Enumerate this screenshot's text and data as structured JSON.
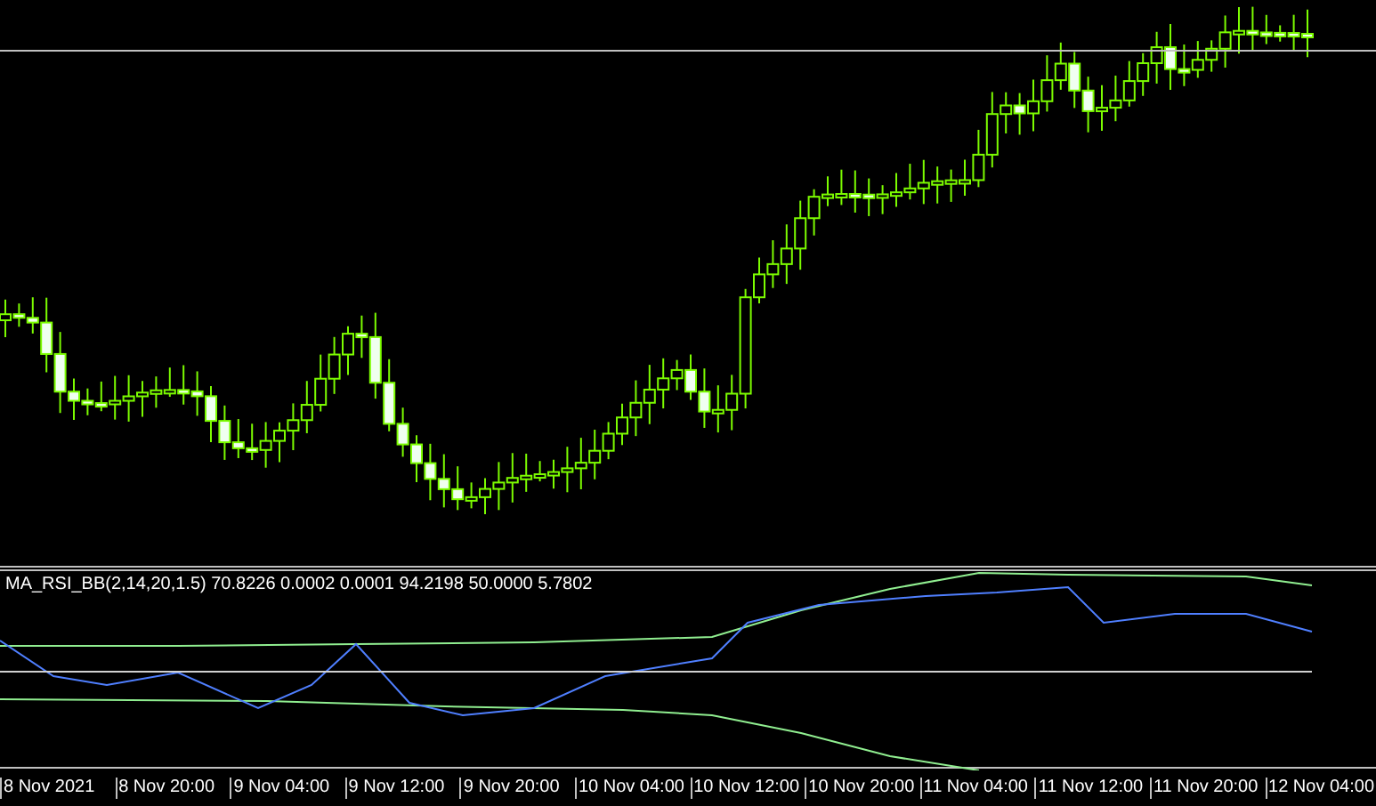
{
  "indicator_pane": {
    "label": "MA_RSI_BB(2,14,20,1.5) 70.8226 0.0002 0.0001 94.2198 50.0000 5.7802"
  },
  "time_axis": {
    "labels": [
      "8 Nov 2021",
      "8 Nov 20:00",
      "9 Nov 04:00",
      "9 Nov 12:00",
      "9 Nov 20:00",
      "10 Nov 04:00",
      "10 Nov 12:00",
      "10 Nov 20:00",
      "11 Nov 04:00",
      "11 Nov 12:00",
      "11 Nov 20:00",
      "12 Nov 04:00"
    ]
  }
}
